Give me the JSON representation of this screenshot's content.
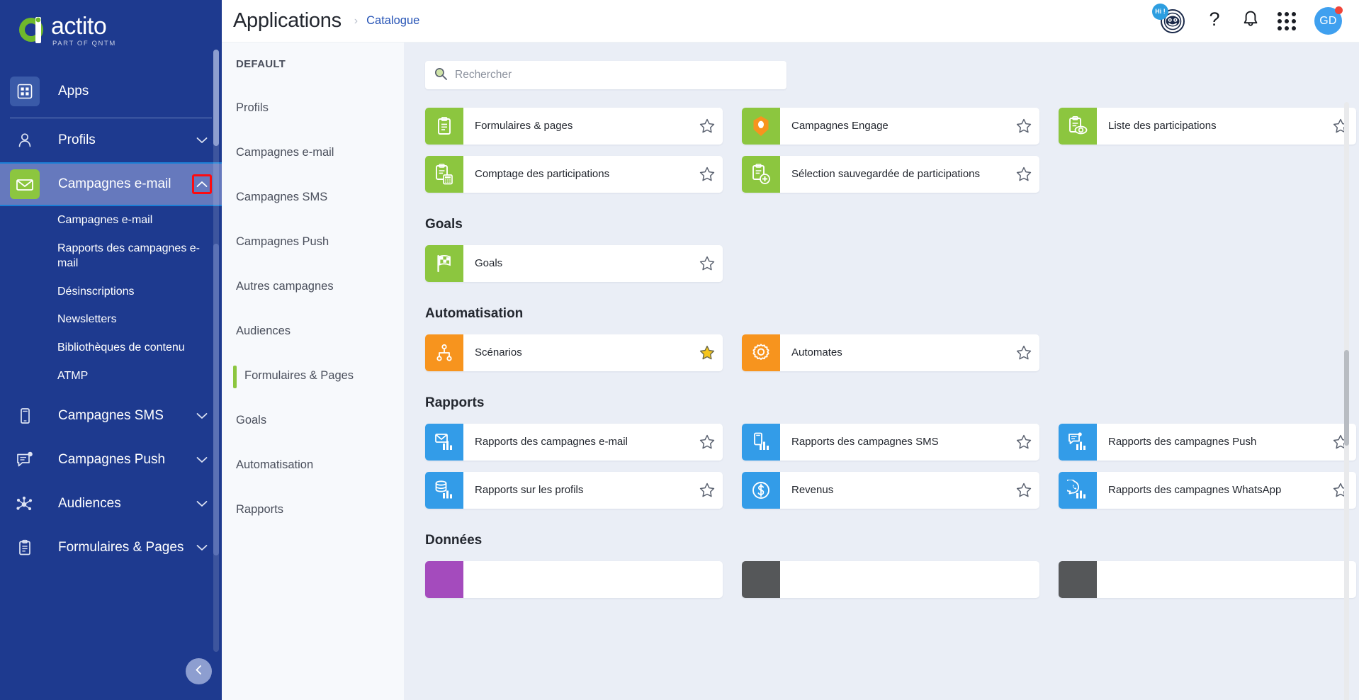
{
  "brand": {
    "name": "actito",
    "tagline": "PART OF QNTM",
    "green": "#6fb92c",
    "blue": "#1e3a8f"
  },
  "sidebar": {
    "apps_label": "Apps",
    "items": [
      {
        "label": "Profils",
        "icon": "person-icon",
        "chevron": "chevron-down-icon",
        "active": false
      },
      {
        "label": "Campagnes e-mail",
        "icon": "envelope-icon",
        "chevron": "chevron-up-icon",
        "active": true
      },
      {
        "label": "Campagnes SMS",
        "icon": "mobile-icon",
        "chevron": "chevron-down-icon",
        "active": false
      },
      {
        "label": "Campagnes Push",
        "icon": "push-message-icon",
        "chevron": "chevron-down-icon",
        "active": false
      },
      {
        "label": "Audiences",
        "icon": "audiences-network-icon",
        "chevron": "chevron-down-icon",
        "active": false
      },
      {
        "label": "Formulaires & Pages",
        "icon": "clipboard-icon",
        "chevron": "chevron-down-icon",
        "active": false
      }
    ],
    "subnav": [
      "Campagnes e-mail",
      "Rapports des campagnes e-mail",
      "Désinscriptions",
      "Newsletters",
      "Bibliothèques de contenu",
      "ATMP"
    ],
    "collapse_icon": "chevron-left-icon"
  },
  "catnav": {
    "items": [
      {
        "label": "DEFAULT",
        "kind": "heading",
        "active": false
      },
      {
        "label": "Profils",
        "kind": "link",
        "active": false
      },
      {
        "label": "Campagnes e-mail",
        "kind": "link",
        "active": false
      },
      {
        "label": "Campagnes SMS",
        "kind": "link",
        "active": false
      },
      {
        "label": "Campagnes Push",
        "kind": "link",
        "active": false
      },
      {
        "label": "Autres campagnes",
        "kind": "link",
        "active": false
      },
      {
        "label": "Audiences",
        "kind": "link",
        "active": false
      },
      {
        "label": "Formulaires & Pages",
        "kind": "link",
        "active": true
      },
      {
        "label": "Goals",
        "kind": "link",
        "active": false
      },
      {
        "label": "Automatisation",
        "kind": "link",
        "active": false
      },
      {
        "label": "Rapports",
        "kind": "link",
        "active": false
      }
    ]
  },
  "header": {
    "title": "Applications",
    "breadcrumb_separator": "›",
    "breadcrumb": "Catalogue",
    "bot_badge": "Hi !",
    "bot_icon": "chatbot-icon",
    "help_icon": "question-mark-icon",
    "bell_icon": "notification-bell-icon",
    "grid_icon": "apps-grid-icon",
    "avatar_initials": "GD"
  },
  "search": {
    "placeholder": "Rechercher",
    "value": "",
    "icon": "search-icon"
  },
  "catalogue": {
    "sections": [
      {
        "title": "",
        "cards": [
          {
            "label": "Formulaires & pages",
            "icon": "clipboard-icon",
            "color": "#8cc63f",
            "starred": false
          },
          {
            "label": "Campagnes Engage",
            "icon": "engage-hex-icon",
            "color": "#8cc63f",
            "starred": false
          },
          {
            "label": "Liste des participations",
            "icon": "clipboard-eye-icon",
            "color": "#8cc63f",
            "starred": false
          },
          {
            "label": "Comptage des participations",
            "icon": "clipboard-calc-icon",
            "color": "#8cc63f",
            "starred": false
          },
          {
            "label": "Sélection sauvegardée de participations",
            "icon": "clipboard-plus-icon",
            "color": "#8cc63f",
            "starred": false
          }
        ]
      },
      {
        "title": "Goals",
        "cards": [
          {
            "label": "Goals",
            "icon": "checkered-flag-icon",
            "color": "#8cc63f",
            "starred": false
          }
        ]
      },
      {
        "title": "Automatisation",
        "cards": [
          {
            "label": "Scénarios",
            "icon": "sitemap-icon",
            "color": "#f7941e",
            "starred": true
          },
          {
            "label": "Automates",
            "icon": "gear-icon",
            "color": "#f7941e",
            "starred": false
          }
        ]
      },
      {
        "title": "Rapports",
        "cards": [
          {
            "label": "Rapports des campagnes e-mail",
            "icon": "email-chart-icon",
            "color": "#339ce8",
            "starred": false
          },
          {
            "label": "Rapports des campagnes SMS",
            "icon": "sms-chart-icon",
            "color": "#339ce8",
            "starred": false
          },
          {
            "label": "Rapports des campagnes Push",
            "icon": "push-chart-icon",
            "color": "#339ce8",
            "starred": false
          },
          {
            "label": "Rapports sur les profils",
            "icon": "database-chart-icon",
            "color": "#339ce8",
            "starred": false
          },
          {
            "label": "Revenus",
            "icon": "dollar-icon",
            "color": "#339ce8",
            "starred": false
          },
          {
            "label": "Rapports des campagnes WhatsApp",
            "icon": "whatsapp-chart-icon",
            "color": "#339ce8",
            "starred": false
          }
        ]
      },
      {
        "title": "Données",
        "cards": [
          {
            "label": "",
            "icon": "",
            "color": "#a44bbd",
            "starred": false
          },
          {
            "label": "",
            "icon": "",
            "color": "#555759",
            "starred": false
          },
          {
            "label": "",
            "icon": "",
            "color": "#555759",
            "starred": false
          }
        ]
      }
    ]
  },
  "annotation": {
    "highlight_color": "#fd0b10",
    "highlight_target": "chevron-up-icon on Campagnes e-mail"
  }
}
